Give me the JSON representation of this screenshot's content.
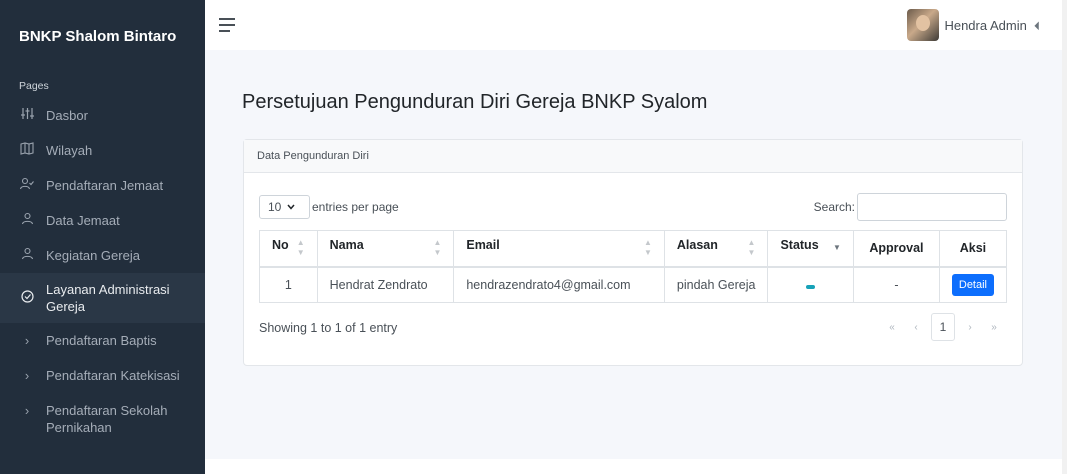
{
  "sidebar": {
    "brand": "BNKP Shalom Bintaro",
    "section_header": "Pages",
    "items": [
      {
        "label": "Dasbor",
        "icon": "sliders-icon"
      },
      {
        "label": "Wilayah",
        "icon": "map-icon"
      },
      {
        "label": "Pendaftaran Jemaat",
        "icon": "user-check-icon"
      },
      {
        "label": "Data Jemaat",
        "icon": "user-icon"
      },
      {
        "label": "Kegiatan Gereja",
        "icon": "user-icon"
      },
      {
        "label": "Layanan Administrasi Gereja",
        "icon": "check-circle-icon"
      },
      {
        "label": "Pendaftaran Baptis",
        "icon": "chevron-right-icon"
      },
      {
        "label": "Pendaftaran Katekisasi",
        "icon": "chevron-right-icon"
      },
      {
        "label": "Pendaftaran Sekolah Pernikahan",
        "icon": "chevron-right-icon"
      }
    ]
  },
  "header": {
    "user_name": "Hendra Admin"
  },
  "main": {
    "page_title": "Persetujuan Pengunduran Diri Gereja BNKP Syalom",
    "card_title": "Data Pengunduran Diri",
    "entries_value": "10",
    "entries_label": "entries per page",
    "search_label": "Search:",
    "search_value": "",
    "columns": [
      "No",
      "Nama",
      "Email",
      "Alasan",
      "Status",
      "Approval",
      "Aksi"
    ],
    "rows": [
      {
        "no": "1",
        "nama": "Hendrat Zendrato",
        "email": "hendrazendrato4@gmail.com",
        "alasan": "pindah Gereja",
        "approval": "-",
        "aksi": "Detail"
      }
    ],
    "showing": "Showing 1 to 1 of 1 entry",
    "pagination": {
      "first": "«",
      "prev": "‹",
      "current": "1",
      "next": "›",
      "last": "»"
    }
  },
  "colors": {
    "sidebar_bg": "#222e3c",
    "primary": "#0d6efd",
    "status": "#17a2b8"
  }
}
